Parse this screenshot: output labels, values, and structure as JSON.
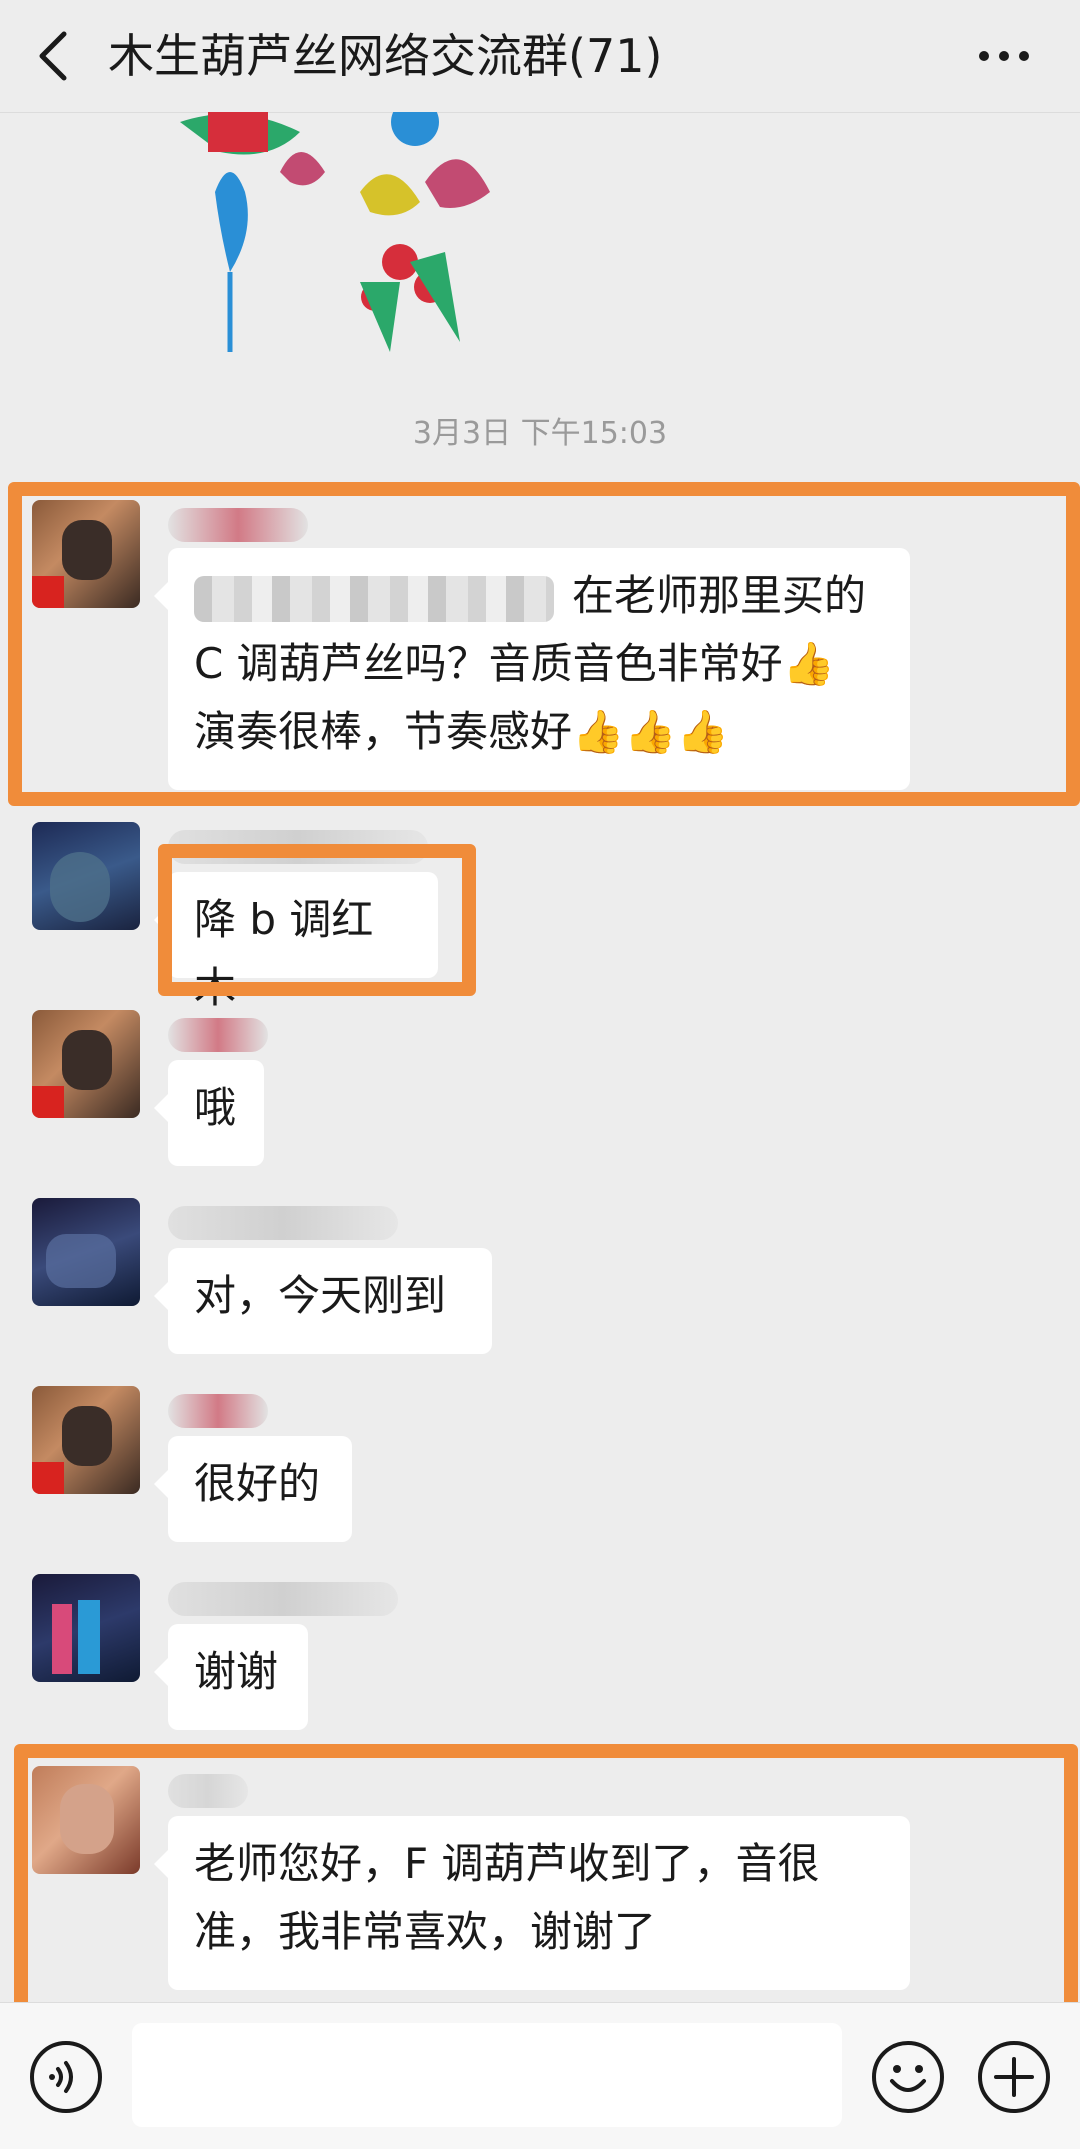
{
  "header": {
    "title": "木生葫芦丝网络交流群(71)",
    "back_icon": "chevron-left-icon",
    "more_icon": "more-dots-icon"
  },
  "chat": {
    "timestamp": "3月3日 下午15:03",
    "messages": [
      {
        "text_tail": "在老师那里买的",
        "line2": "C 调葫芦丝吗？音质音色非常好👍",
        "line3": "演奏很棒，节奏感好👍👍👍"
      },
      {
        "text": "降 b 调红木"
      },
      {
        "text": "哦"
      },
      {
        "text": "对，今天刚到"
      },
      {
        "text": "很好的"
      },
      {
        "text": "谢谢"
      },
      {
        "line1": "老师您好，F 调葫芦收到了，音很",
        "line2": "准，我非常喜欢，谢谢了"
      }
    ]
  },
  "inputbar": {
    "placeholder": "",
    "voice_icon": "voice-icon",
    "emoji_icon": "emoji-icon",
    "plus_icon": "plus-icon"
  },
  "colors": {
    "highlight": "#f08c3a",
    "background": "#ededed",
    "bubble": "#ffffff"
  }
}
